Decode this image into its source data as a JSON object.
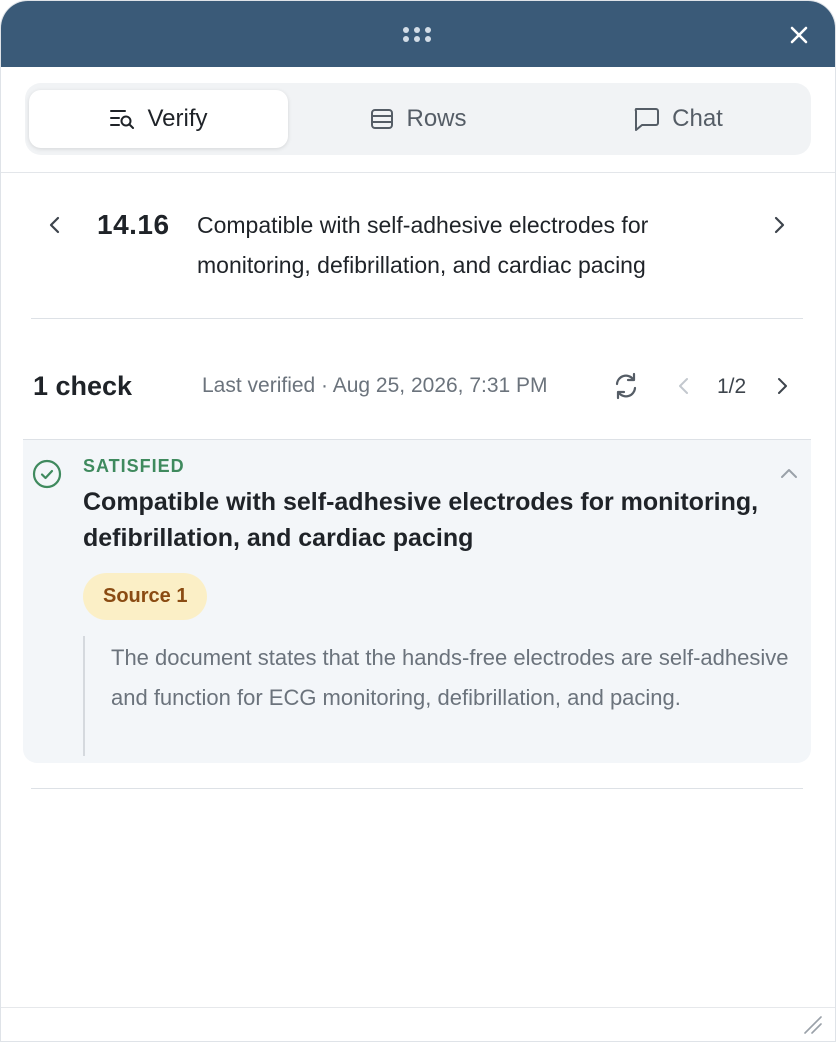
{
  "titlebar": {
    "drag_icon": "grip-dots-icon",
    "close_icon": "close-icon"
  },
  "tabs": [
    {
      "label": "Verify",
      "icon": "verify-list-search-icon",
      "active": true
    },
    {
      "label": "Rows",
      "icon": "table-rows-icon",
      "active": false
    },
    {
      "label": "Chat",
      "icon": "chat-bubble-icon",
      "active": false
    }
  ],
  "requirement": {
    "number": "14.16",
    "text": "Compatible with self-adhesive electrodes for monitoring, defibrillation, and cardiac pacing"
  },
  "checks": {
    "count_label": "1 check",
    "last_verified": "Last verified · Aug 25, 2026, 7:31 PM",
    "pager": "1/2"
  },
  "check_card": {
    "status": "SATISFIED",
    "title": "Compatible with self-adhesive electrodes for monitoring, defibrillation, and cardiac pacing",
    "source_label": "Source 1",
    "quote": "The document states that the hands-free electrodes are self-adhesive and function for ECG monitoring, defibrillation, and pacing."
  },
  "colors": {
    "titlebar": "#3a5a78",
    "satisfied": "#3f8a5e",
    "source_badge_bg": "#fbefc6",
    "source_badge_text": "#8a4b12"
  }
}
